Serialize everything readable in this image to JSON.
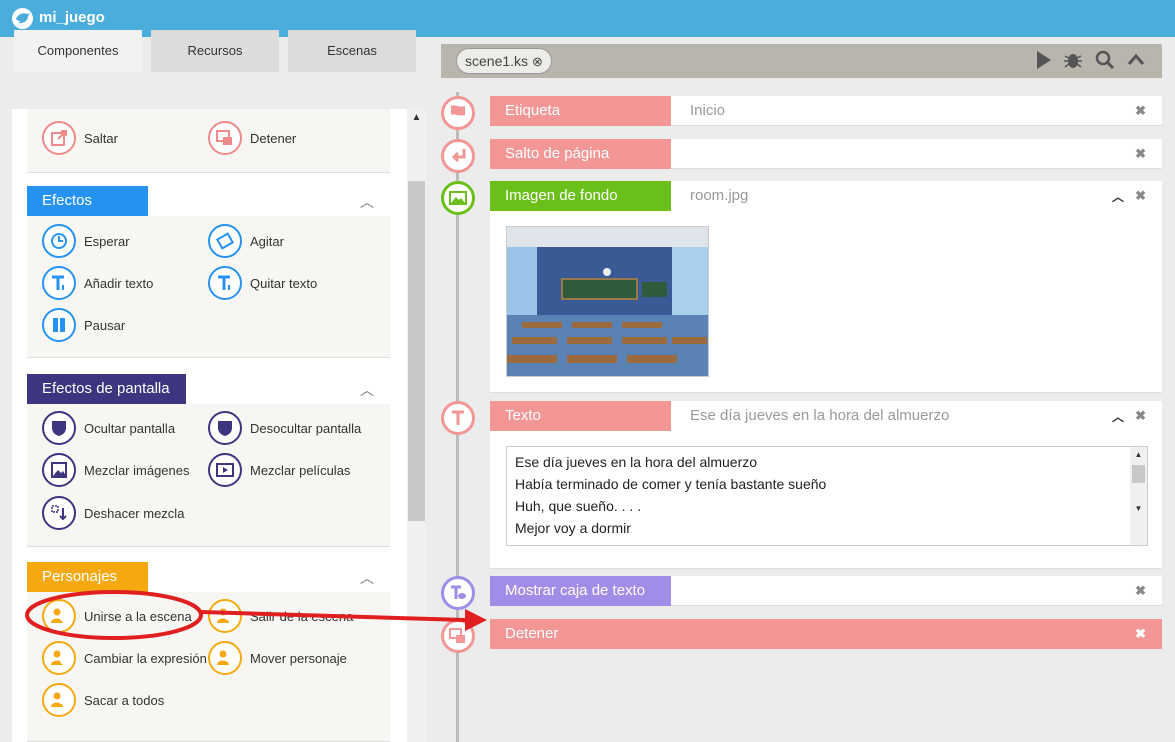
{
  "app": {
    "name": "mi_juego"
  },
  "left_tabs": [
    {
      "label": "Componentes",
      "active": true
    },
    {
      "label": "Recursos",
      "active": false
    },
    {
      "label": "Escenas",
      "active": false
    }
  ],
  "top_panel": {
    "items": [
      {
        "label": "Saltar",
        "icon": "jump-icon"
      },
      {
        "label": "Detener",
        "icon": "stop-icon"
      }
    ],
    "color": "#ef8a8a"
  },
  "panels": [
    {
      "title": "Efectos",
      "color": "#2693f2",
      "items": [
        {
          "label": "Esperar",
          "icon": "clock-icon"
        },
        {
          "label": "Agitar",
          "icon": "shake-icon"
        },
        {
          "label": "Añadir texto",
          "icon": "add-text-icon"
        },
        {
          "label": "Quitar texto",
          "icon": "remove-text-icon"
        },
        {
          "label": "Pausar",
          "icon": "pause-icon"
        }
      ]
    },
    {
      "title": "Efectos de pantalla",
      "color": "#3d3580",
      "items": [
        {
          "label": "Ocultar pantalla",
          "icon": "hide-screen-icon"
        },
        {
          "label": "Desocultar pantalla",
          "icon": "show-screen-icon"
        },
        {
          "label": "Mezclar imágenes",
          "icon": "image-mix-icon"
        },
        {
          "label": "Mezclar películas",
          "icon": "movie-mix-icon"
        },
        {
          "label": "Deshacer mezcla",
          "icon": "undo-mix-icon"
        }
      ]
    },
    {
      "title": "Personajes",
      "color": "#f5a90f",
      "items": [
        {
          "label": "Unirse a la escena",
          "icon": "join-scene-icon"
        },
        {
          "label": "Salir de la escena",
          "icon": "leave-scene-icon"
        },
        {
          "label": "Cambiar la expresión",
          "icon": "change-expression-icon"
        },
        {
          "label": "Mover personaje",
          "icon": "move-character-icon"
        },
        {
          "label": "Sacar a todos",
          "icon": "remove-all-icon"
        }
      ]
    }
  ],
  "scene": {
    "tab_label": "scene1.ks",
    "toolbar": [
      "play-icon",
      "debug-bug-icon",
      "search-icon",
      "collapse-icon"
    ],
    "commands": [
      {
        "label": "Etiqueta",
        "value": "Inicio",
        "color": "#f29696"
      },
      {
        "label": "Salto de página",
        "value": "",
        "color": "#f29696"
      },
      {
        "label": "Imagen de fondo",
        "value": "room.jpg",
        "color": "#6bbf1a"
      },
      {
        "label": "Texto",
        "value": "Ese día jueves en la hora del almuerzo",
        "color": "#f29696",
        "text_lines": [
          "Ese día jueves en la hora del almuerzo",
          "Había terminado de comer y tenía bastante sueño",
          "Huh, que sueño. . . .",
          "Mejor voy a dormir"
        ]
      },
      {
        "label": "Mostrar caja de texto",
        "value": "",
        "color": "#a08de8"
      },
      {
        "label": "Detener",
        "value": "",
        "color": "#f29696"
      }
    ]
  },
  "annotation_color": "#e02020"
}
